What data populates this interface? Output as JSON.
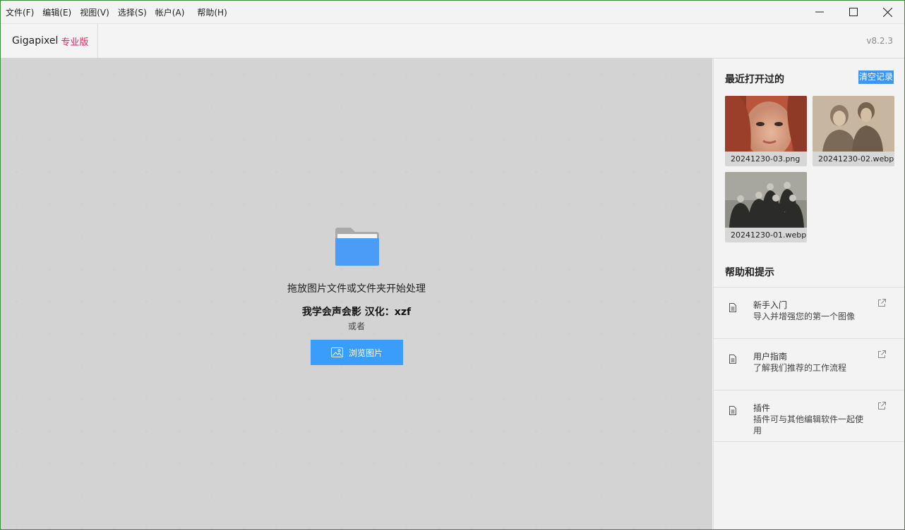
{
  "menubar": {
    "items": [
      "文件(F)",
      "编辑(E)",
      "视图(V)",
      "选择(S)",
      "帐户(A)",
      "帮助(H)"
    ]
  },
  "header": {
    "brand_name": "Gigapixel",
    "brand_edition": "专业版",
    "version": "v8.2.3"
  },
  "main": {
    "drop_text": "拖放图片文件或文件夹开始处理",
    "credit_text": "我学会声会影 汉化：xzf",
    "or_text": "或者",
    "browse_label": "浏览图片"
  },
  "sidebar": {
    "recent_title": "最近打开过的",
    "clear_label": "清空记录",
    "recent_files": [
      {
        "name": "20241230-03.png"
      },
      {
        "name": "20241230-02.webp"
      },
      {
        "name": "20241230-01.webp"
      }
    ],
    "help_title": "帮助和提示",
    "help_items": [
      {
        "title": "新手入门",
        "desc": "导入并增强您的第一个图像"
      },
      {
        "title": "用户指南",
        "desc": "了解我们推荐的工作流程"
      },
      {
        "title": "插件",
        "desc": "插件可与其他编辑软件一起使用"
      }
    ]
  },
  "colors": {
    "accent": "#3a9cfb",
    "brand_edition": "#e0245e",
    "window_border": "#3f8a3f"
  },
  "icons": [
    "folder-icon",
    "image-icon",
    "document-icon",
    "external-link-icon",
    "minimize-icon",
    "maximize-icon",
    "close-icon"
  ]
}
